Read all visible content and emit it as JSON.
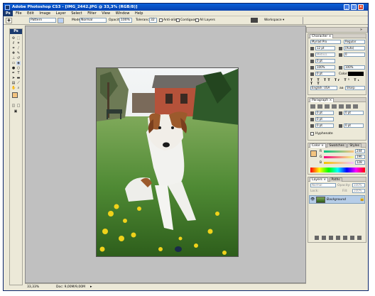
{
  "titlebar": {
    "title": "Adobe Photoshop CS3 - [IMG_2442.JPG @ 33,3% (RGB/8)]",
    "min": "_",
    "max": "□",
    "close": "×"
  },
  "menu": [
    "Ps",
    "File",
    "Edit",
    "Image",
    "Layer",
    "Select",
    "Filter",
    "View",
    "Window",
    "Help"
  ],
  "options": {
    "pattern_value": "Pattern",
    "mode_label": "Mode:",
    "mode_value": "Normal",
    "opacity_label": "Opacity:",
    "opacity_value": "100%",
    "tolerance_label": "Tolerance:",
    "tolerance_value": "32",
    "antialias_label": "Anti-alias",
    "contiguous_label": "Contiguous",
    "all_layers_label": "All Layers",
    "workspace_label": "Workspace ▾"
  },
  "status": {
    "zoom": "33,33%",
    "doc": "Doc: 9,00M/9,00M"
  },
  "character": {
    "tabs": [
      "Character ×",
      "Paragraph"
    ],
    "font": "Myriad Pro",
    "style": "Regular",
    "size": "12 pt",
    "leading": "(Auto)",
    "kerning": "Metrics",
    "tracking": "0",
    "vscale": "0 pt",
    "baseline": "0 pt",
    "hscale": "100%",
    "vscale2": "100%",
    "color_label": "Color:",
    "language": "English: USA",
    "aa_label": "aa",
    "antialias": "Sharp",
    "styles": [
      "T",
      "T",
      "TT",
      "Tr",
      "T¹",
      "T₁",
      "T",
      "T"
    ]
  },
  "paragraph": {
    "tabs": [
      "Paragraph ×"
    ],
    "values": [
      "0 pt",
      "0 pt",
      "0 pt",
      "0 pt",
      "0 pt"
    ],
    "hyphenate": "Hyphenate"
  },
  "color": {
    "tabs": [
      "Color ×",
      "Swatches",
      "Styles"
    ],
    "r": "244",
    "g": "196",
    "b": "128",
    "labels": [
      "R",
      "G",
      "B"
    ]
  },
  "layers": {
    "tabs": [
      "Layers ×",
      "Paths"
    ],
    "blend": "Normal",
    "opacity_label": "Opacity:",
    "opacity": "100%",
    "lock_label": "Lock:",
    "fill_label": "Fill:",
    "fill": "100%",
    "layer_name": "Background"
  },
  "colors": {
    "fg": "#f4c480",
    "accent": "#0a246a"
  }
}
